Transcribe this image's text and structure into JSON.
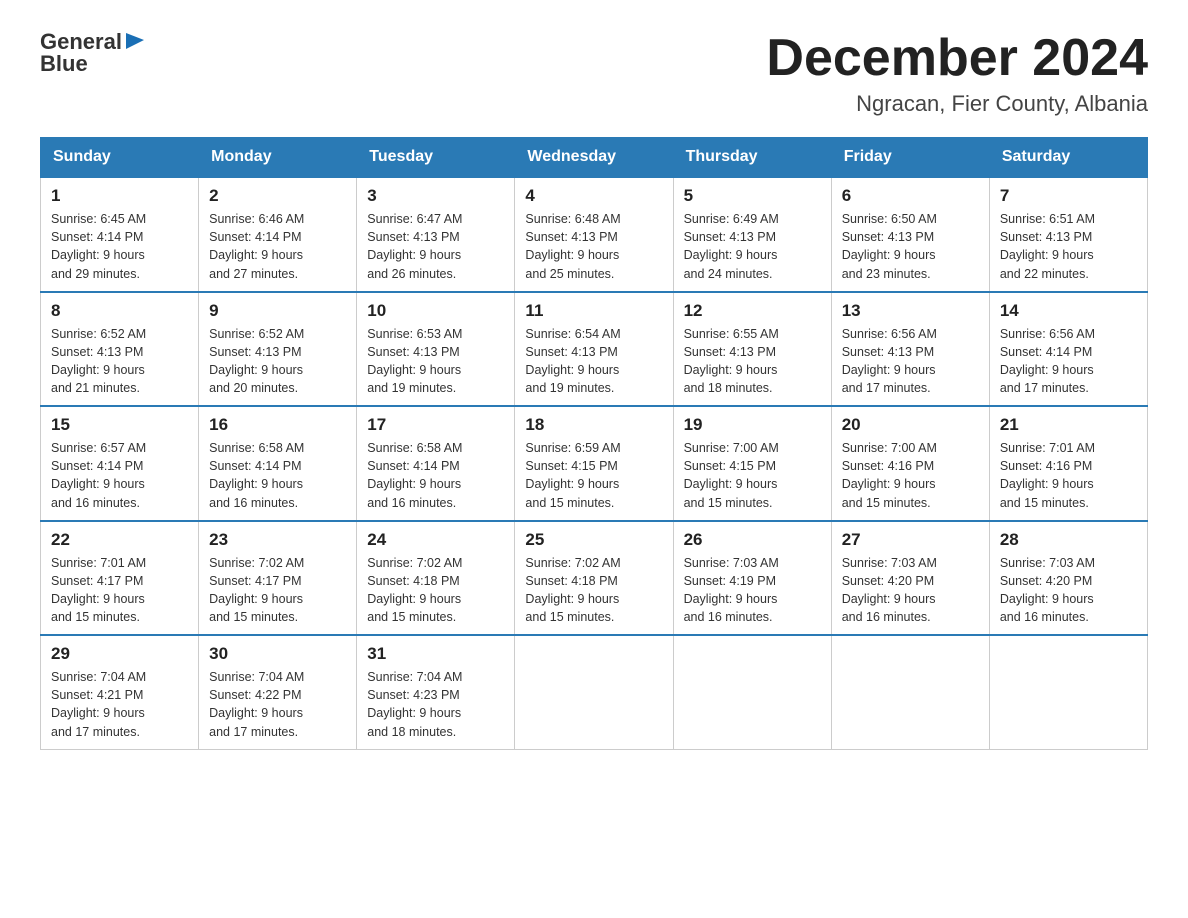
{
  "logo": {
    "line1": "General",
    "line2": "Blue"
  },
  "title": "December 2024",
  "subtitle": "Ngracan, Fier County, Albania",
  "headers": [
    "Sunday",
    "Monday",
    "Tuesday",
    "Wednesday",
    "Thursday",
    "Friday",
    "Saturday"
  ],
  "weeks": [
    [
      {
        "num": "1",
        "sunrise": "6:45 AM",
        "sunset": "4:14 PM",
        "daylight": "9 hours and 29 minutes."
      },
      {
        "num": "2",
        "sunrise": "6:46 AM",
        "sunset": "4:14 PM",
        "daylight": "9 hours and 27 minutes."
      },
      {
        "num": "3",
        "sunrise": "6:47 AM",
        "sunset": "4:13 PM",
        "daylight": "9 hours and 26 minutes."
      },
      {
        "num": "4",
        "sunrise": "6:48 AM",
        "sunset": "4:13 PM",
        "daylight": "9 hours and 25 minutes."
      },
      {
        "num": "5",
        "sunrise": "6:49 AM",
        "sunset": "4:13 PM",
        "daylight": "9 hours and 24 minutes."
      },
      {
        "num": "6",
        "sunrise": "6:50 AM",
        "sunset": "4:13 PM",
        "daylight": "9 hours and 23 minutes."
      },
      {
        "num": "7",
        "sunrise": "6:51 AM",
        "sunset": "4:13 PM",
        "daylight": "9 hours and 22 minutes."
      }
    ],
    [
      {
        "num": "8",
        "sunrise": "6:52 AM",
        "sunset": "4:13 PM",
        "daylight": "9 hours and 21 minutes."
      },
      {
        "num": "9",
        "sunrise": "6:52 AM",
        "sunset": "4:13 PM",
        "daylight": "9 hours and 20 minutes."
      },
      {
        "num": "10",
        "sunrise": "6:53 AM",
        "sunset": "4:13 PM",
        "daylight": "9 hours and 19 minutes."
      },
      {
        "num": "11",
        "sunrise": "6:54 AM",
        "sunset": "4:13 PM",
        "daylight": "9 hours and 19 minutes."
      },
      {
        "num": "12",
        "sunrise": "6:55 AM",
        "sunset": "4:13 PM",
        "daylight": "9 hours and 18 minutes."
      },
      {
        "num": "13",
        "sunrise": "6:56 AM",
        "sunset": "4:13 PM",
        "daylight": "9 hours and 17 minutes."
      },
      {
        "num": "14",
        "sunrise": "6:56 AM",
        "sunset": "4:14 PM",
        "daylight": "9 hours and 17 minutes."
      }
    ],
    [
      {
        "num": "15",
        "sunrise": "6:57 AM",
        "sunset": "4:14 PM",
        "daylight": "9 hours and 16 minutes."
      },
      {
        "num": "16",
        "sunrise": "6:58 AM",
        "sunset": "4:14 PM",
        "daylight": "9 hours and 16 minutes."
      },
      {
        "num": "17",
        "sunrise": "6:58 AM",
        "sunset": "4:14 PM",
        "daylight": "9 hours and 16 minutes."
      },
      {
        "num": "18",
        "sunrise": "6:59 AM",
        "sunset": "4:15 PM",
        "daylight": "9 hours and 15 minutes."
      },
      {
        "num": "19",
        "sunrise": "7:00 AM",
        "sunset": "4:15 PM",
        "daylight": "9 hours and 15 minutes."
      },
      {
        "num": "20",
        "sunrise": "7:00 AM",
        "sunset": "4:16 PM",
        "daylight": "9 hours and 15 minutes."
      },
      {
        "num": "21",
        "sunrise": "7:01 AM",
        "sunset": "4:16 PM",
        "daylight": "9 hours and 15 minutes."
      }
    ],
    [
      {
        "num": "22",
        "sunrise": "7:01 AM",
        "sunset": "4:17 PM",
        "daylight": "9 hours and 15 minutes."
      },
      {
        "num": "23",
        "sunrise": "7:02 AM",
        "sunset": "4:17 PM",
        "daylight": "9 hours and 15 minutes."
      },
      {
        "num": "24",
        "sunrise": "7:02 AM",
        "sunset": "4:18 PM",
        "daylight": "9 hours and 15 minutes."
      },
      {
        "num": "25",
        "sunrise": "7:02 AM",
        "sunset": "4:18 PM",
        "daylight": "9 hours and 15 minutes."
      },
      {
        "num": "26",
        "sunrise": "7:03 AM",
        "sunset": "4:19 PM",
        "daylight": "9 hours and 16 minutes."
      },
      {
        "num": "27",
        "sunrise": "7:03 AM",
        "sunset": "4:20 PM",
        "daylight": "9 hours and 16 minutes."
      },
      {
        "num": "28",
        "sunrise": "7:03 AM",
        "sunset": "4:20 PM",
        "daylight": "9 hours and 16 minutes."
      }
    ],
    [
      {
        "num": "29",
        "sunrise": "7:04 AM",
        "sunset": "4:21 PM",
        "daylight": "9 hours and 17 minutes."
      },
      {
        "num": "30",
        "sunrise": "7:04 AM",
        "sunset": "4:22 PM",
        "daylight": "9 hours and 17 minutes."
      },
      {
        "num": "31",
        "sunrise": "7:04 AM",
        "sunset": "4:23 PM",
        "daylight": "9 hours and 18 minutes."
      },
      null,
      null,
      null,
      null
    ]
  ],
  "labels": {
    "sunrise": "Sunrise:",
    "sunset": "Sunset:",
    "daylight": "Daylight:"
  }
}
